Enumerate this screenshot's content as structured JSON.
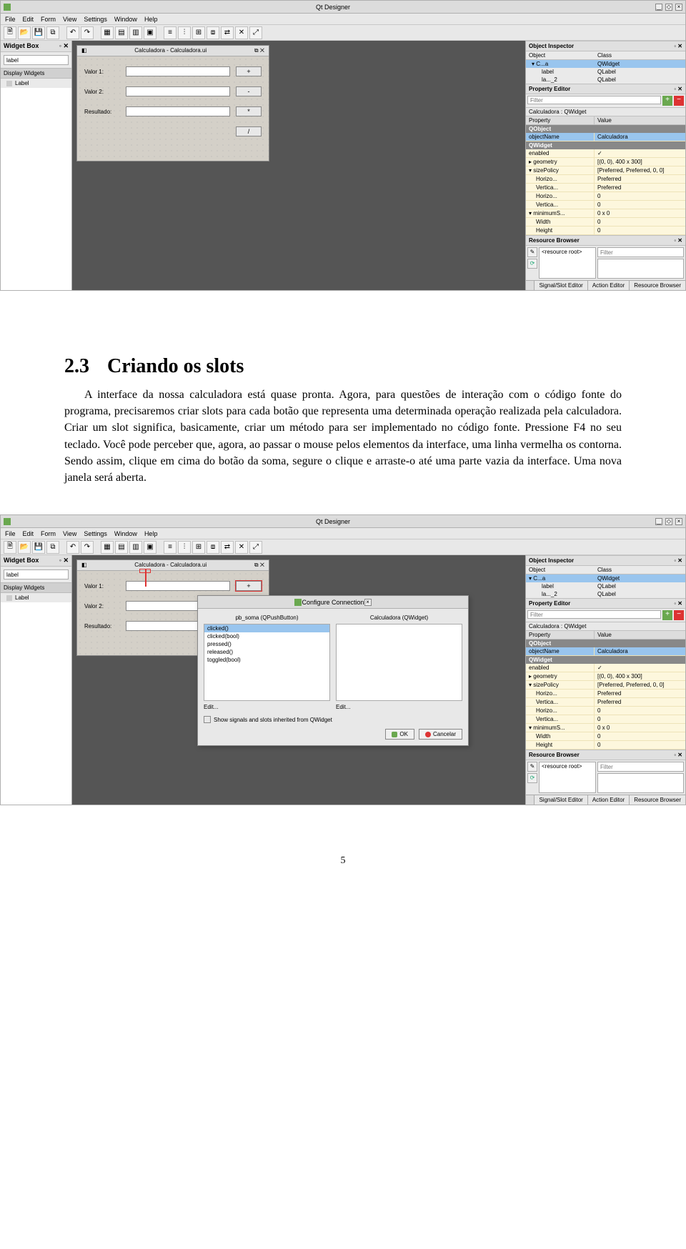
{
  "doc": {
    "section_number": "2.3",
    "section_title": "Criando os slots",
    "paragraph": "A interface da nossa calculadora está quase pronta. Agora, para questões de interação com o código fonte do programa, precisaremos criar slots para cada botão que representa uma determinada operação realizada pela calculadora. Criar um slot significa, basicamente, criar um método para ser implementado no código fonte. Pressione F4 no seu teclado. Você pode perceber que, agora, ao passar o mouse pelos elementos da interface, uma linha vermelha os contorna. Sendo assim, clique em cima do botão da soma, segure o clique e arraste-o até uma parte vazia da interface. Uma nova janela será aberta.",
    "page_number": "5"
  },
  "window": {
    "title": "Qt Designer",
    "menus": [
      "File",
      "Edit",
      "Form",
      "View",
      "Settings",
      "Window",
      "Help"
    ],
    "widgetbox": {
      "title": "Widget Box",
      "filter_value": "label",
      "group": "Display Widgets",
      "item": "Label"
    },
    "form": {
      "title": "Calculadora - Calculadora.ui",
      "labels": {
        "v1": "Valor 1:",
        "v2": "Valor 2:",
        "res": "Resultado:"
      },
      "buttons": {
        "plus": "+",
        "minus": "-",
        "mul": "*",
        "div": "/"
      }
    },
    "object_inspector": {
      "title": "Object Inspector",
      "cols": {
        "c1": "Object",
        "c2": "Class"
      },
      "rows": [
        {
          "name": "C...a",
          "class": "QWidget",
          "sel": true,
          "indent": 0
        },
        {
          "name": "label",
          "class": "QLabel",
          "sel": false,
          "indent": 1
        },
        {
          "name": "la..._2",
          "class": "QLabel",
          "sel": false,
          "indent": 1
        }
      ]
    },
    "property_editor": {
      "title": "Property Editor",
      "filter": "Filter",
      "context": "Calculadora : QWidget",
      "cols": {
        "c1": "Property",
        "c2": "Value"
      },
      "sections": {
        "s1": "QObject",
        "s2": "QWidget"
      },
      "rows": {
        "objectName": {
          "k": "objectName",
          "v": "Calculadora"
        },
        "enabled": {
          "k": "enabled",
          "v": "✓"
        },
        "geometry": {
          "k": "geometry",
          "v": "[(0, 0), 400 x 300]"
        },
        "sizePolicy": {
          "k": "sizePolicy",
          "v": "[Preferred, Preferred, 0, 0]"
        },
        "horiz": {
          "k": "Horizo...",
          "v": "Preferred"
        },
        "vert": {
          "k": "Vertica...",
          "v": "Preferred"
        },
        "horizv": {
          "k": "Horizo...",
          "v": "0"
        },
        "vertv": {
          "k": "Vertica...",
          "v": "0"
        },
        "minSize": {
          "k": "minimumS...",
          "v": "0 x 0"
        },
        "width": {
          "k": "Width",
          "v": "0"
        },
        "height": {
          "k": "Height",
          "v": "0"
        }
      }
    },
    "resource_browser": {
      "title": "Resource Browser",
      "filter": "Filter",
      "root": "<resource root>"
    },
    "bottom_tabs": [
      "Signal/Slot Editor",
      "Action Editor",
      "Resource Browser"
    ]
  },
  "dialog": {
    "title": "Configure Connection",
    "left_label": "pb_soma (QPushButton)",
    "right_label": "Calculadora (QWidget)",
    "signals": [
      "clicked()",
      "clicked(bool)",
      "pressed()",
      "released()",
      "toggled(bool)"
    ],
    "edit": "Edit...",
    "checkbox": "Show signals and slots inherited from QWidget",
    "ok": "OK",
    "cancel": "Cancelar"
  }
}
